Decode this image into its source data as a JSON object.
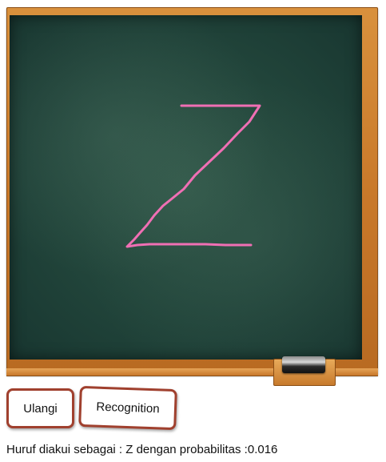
{
  "chalkboard": {
    "stroke_color": "#f06fb4",
    "frame_color": "#c9792a",
    "surface_color": "#23463b"
  },
  "buttons": {
    "reset_label": "Ulangi",
    "recognize_label": "Recognition",
    "border_color": "#a0402e"
  },
  "result": {
    "text": "Huruf diakui sebagai : Z dengan probabilitas :0.016"
  }
}
